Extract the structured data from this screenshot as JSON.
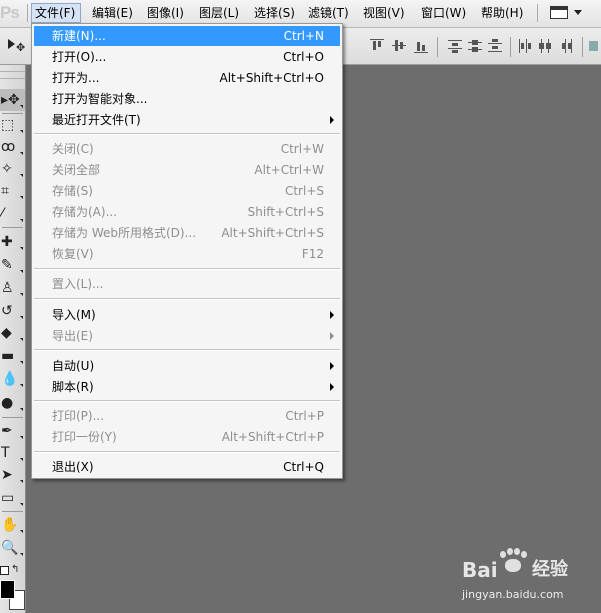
{
  "app": {
    "logo_text": "Ps"
  },
  "menubar": {
    "items": [
      {
        "label": "文件(F)",
        "active": true
      },
      {
        "label": "编辑(E)"
      },
      {
        "label": "图像(I)"
      },
      {
        "label": "图层(L)"
      },
      {
        "label": "选择(S)"
      },
      {
        "label": "滤镜(T)"
      },
      {
        "label": "视图(V)"
      },
      {
        "label": "窗口(W)"
      },
      {
        "label": "帮助(H)"
      }
    ],
    "screen_mode_icon": "screen-mode-icon"
  },
  "options_bar": {
    "tool_icon": "move-tool-icon",
    "align_icons": [
      "align-top-icon",
      "align-vertical-center-icon",
      "align-bottom-icon",
      "distribute-top-icon",
      "distribute-center-icon",
      "distribute-bottom-icon",
      "distribute-left-icon",
      "distribute-hcenter-icon"
    ]
  },
  "toolbox": {
    "tools": [
      {
        "name": "move-tool-icon",
        "glyph": "▸✥",
        "active": true
      },
      {
        "name": "marquee-tool-icon",
        "glyph": "⬚"
      },
      {
        "name": "lasso-tool-icon",
        "glyph": "ꝏ"
      },
      {
        "name": "quick-selection-tool-icon",
        "glyph": "✧"
      },
      {
        "name": "crop-tool-icon",
        "glyph": "⌗"
      },
      {
        "name": "eyedropper-tool-icon",
        "glyph": "⁄"
      },
      {
        "name": "spot-healing-tool-icon",
        "glyph": "✚"
      },
      {
        "name": "brush-tool-icon",
        "glyph": "✎"
      },
      {
        "name": "clone-stamp-tool-icon",
        "glyph": "♙"
      },
      {
        "name": "history-brush-tool-icon",
        "glyph": "↺"
      },
      {
        "name": "eraser-tool-icon",
        "glyph": "◆"
      },
      {
        "name": "gradient-tool-icon",
        "glyph": "▬"
      },
      {
        "name": "blur-tool-icon",
        "glyph": "💧"
      },
      {
        "name": "dodge-tool-icon",
        "glyph": "●"
      },
      {
        "name": "pen-tool-icon",
        "glyph": "✒"
      },
      {
        "name": "type-tool-icon",
        "glyph": "T"
      },
      {
        "name": "path-selection-tool-icon",
        "glyph": "➤"
      },
      {
        "name": "shape-tool-icon",
        "glyph": "▭"
      },
      {
        "name": "hand-tool-icon",
        "glyph": "✋"
      },
      {
        "name": "zoom-tool-icon",
        "glyph": "🔍"
      }
    ],
    "foreground_color": "#000000",
    "background_color": "#ffffff"
  },
  "file_menu": {
    "highlight_color": "#3399ff",
    "items": [
      {
        "label": "新建(N)...",
        "shortcut": "Ctrl+N",
        "highlighted": true
      },
      {
        "label": "打开(O)...",
        "shortcut": "Ctrl+O"
      },
      {
        "label": "打开为...",
        "shortcut": "Alt+Shift+Ctrl+O"
      },
      {
        "label": "打开为智能对象...",
        "shortcut": ""
      },
      {
        "label": "最近打开文件(T)",
        "shortcut": "",
        "submenu": true
      },
      {
        "separator": true
      },
      {
        "label": "关闭(C)",
        "shortcut": "Ctrl+W",
        "disabled": true
      },
      {
        "label": "关闭全部",
        "shortcut": "Alt+Ctrl+W",
        "disabled": true
      },
      {
        "label": "存储(S)",
        "shortcut": "Ctrl+S",
        "disabled": true
      },
      {
        "label": "存储为(A)...",
        "shortcut": "Shift+Ctrl+S",
        "disabled": true
      },
      {
        "label": "存储为 Web所用格式(D)...",
        "shortcut": "Alt+Shift+Ctrl+S",
        "disabled": true
      },
      {
        "label": "恢复(V)",
        "shortcut": "F12",
        "disabled": true
      },
      {
        "separator": true
      },
      {
        "label": "置入(L)...",
        "shortcut": "",
        "disabled": true
      },
      {
        "separator": true
      },
      {
        "label": "导入(M)",
        "shortcut": "",
        "submenu": true
      },
      {
        "label": "导出(E)",
        "shortcut": "",
        "submenu": true,
        "disabled": true
      },
      {
        "separator": true
      },
      {
        "label": "自动(U)",
        "shortcut": "",
        "submenu": true
      },
      {
        "label": "脚本(R)",
        "shortcut": "",
        "submenu": true
      },
      {
        "separator": true
      },
      {
        "label": "打印(P)...",
        "shortcut": "Ctrl+P",
        "disabled": true
      },
      {
        "label": "打印一份(Y)",
        "shortcut": "Alt+Shift+Ctrl+P",
        "disabled": true
      },
      {
        "separator": true
      },
      {
        "label": "退出(X)",
        "shortcut": "Ctrl+Q"
      }
    ]
  },
  "watermark": {
    "brand_left": "Bai",
    "brand_right": "经验",
    "paw_icon": "baidu-paw-icon",
    "url": "jingyan.baidu.com"
  }
}
